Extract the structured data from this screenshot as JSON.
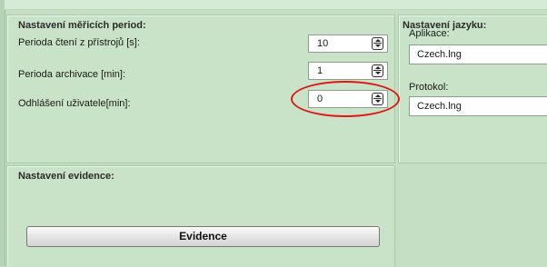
{
  "periods": {
    "title": "Nastavení měřicích period:",
    "rows": [
      {
        "label": "Perioda čtení z přístrojů [s]:",
        "value": "10"
      },
      {
        "label": "Perioda archivace [min]:",
        "value": "1"
      },
      {
        "label": "Odhlášení uživatele[min]:",
        "value": "0"
      }
    ]
  },
  "language": {
    "title": "Nastavení jazyku:",
    "app_label": "Aplikace:",
    "app_value": "Czech.lng",
    "protocol_label": "Protokol:",
    "protocol_value": "Czech.lng"
  },
  "evidence": {
    "title": "Nastavení evidence:",
    "button_label": "Evidence"
  },
  "colors": {
    "background": "#c4dfc4",
    "highlight": "#e01515"
  }
}
